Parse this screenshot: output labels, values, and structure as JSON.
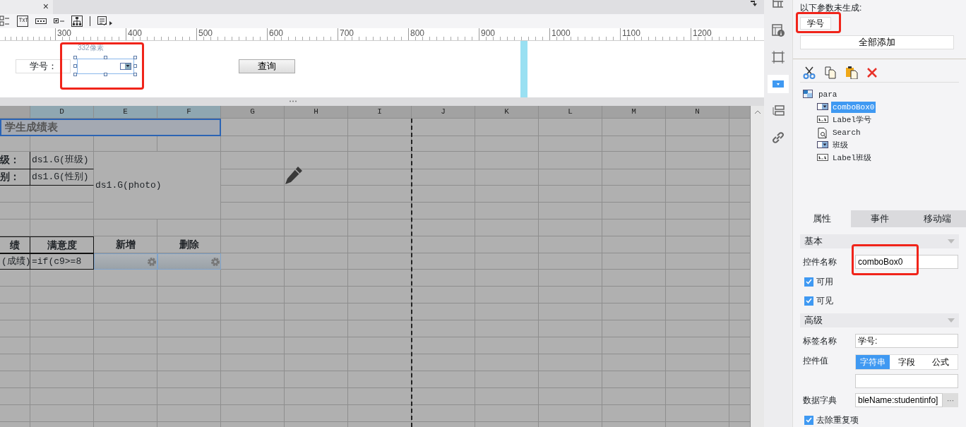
{
  "tab_bar": {
    "close": "×"
  },
  "ruler": {
    "labels": [
      "300",
      "400",
      "500",
      "600",
      "700",
      "800",
      "900",
      "1000",
      "1100",
      "1200"
    ]
  },
  "param_pane": {
    "label": "学号：",
    "size_hint": "332像素",
    "query_button": "查询"
  },
  "sheet": {
    "columns": [
      {
        "selected": false
      },
      {
        "label": "D",
        "selected": true
      },
      {
        "label": "E",
        "selected": true
      },
      {
        "label": "F",
        "selected": true
      },
      {
        "label": "G",
        "selected": false
      },
      {
        "label": "H",
        "selected": false
      },
      {
        "label": "I",
        "selected": false
      },
      {
        "label": "J",
        "selected": false
      },
      {
        "label": "K",
        "selected": false
      },
      {
        "label": "L",
        "selected": false
      },
      {
        "label": "M",
        "selected": false
      },
      {
        "label": "N",
        "selected": false
      }
    ],
    "cells": [
      {
        "kind": "title",
        "text": "学生成绩表",
        "selected": true
      },
      {
        "kind": "label",
        "text": "级：",
        "selected": false
      },
      {
        "kind": "formula",
        "text": "ds1.G(班级)",
        "selected": false
      },
      {
        "kind": "label",
        "text": "别：",
        "selected": false
      },
      {
        "kind": "formula",
        "text": "ds1.G(性别)",
        "selected": false
      },
      {
        "kind": "formula",
        "text": "ds1.G(photo)",
        "selected": false
      },
      {
        "kind": "header",
        "text": "绩",
        "selected": false
      },
      {
        "kind": "header",
        "text": "满意度",
        "selected": false
      },
      {
        "kind": "header",
        "text": "新增",
        "selected": false
      },
      {
        "kind": "header",
        "text": "删除",
        "selected": false
      },
      {
        "kind": "formula",
        "text": "(成绩)",
        "selected": false
      },
      {
        "kind": "formula",
        "text": "=if(c9>=8",
        "selected": false
      },
      {
        "kind": "widget",
        "selected": false
      },
      {
        "kind": "widget",
        "selected": false
      }
    ]
  },
  "side_strip": {
    "items": [
      {
        "kind": "layout",
        "selected": false
      },
      {
        "kind": "info",
        "selected": false
      },
      {
        "kind": "frame",
        "selected": false
      },
      {
        "kind": "combo",
        "selected": true
      },
      {
        "kind": "list",
        "selected": false
      },
      {
        "kind": "link",
        "selected": false
      }
    ]
  },
  "params": {
    "heading": "以下参数未生成:",
    "pending": [
      "学号"
    ],
    "add_all": "全部添加"
  },
  "widget_tree": {
    "label": "para",
    "kind": "panel",
    "selected": false,
    "children": [
      {
        "label": "comboBox0",
        "kind": "combo",
        "selected": true
      },
      {
        "label": "Label学号",
        "kind": "label",
        "selected": false
      },
      {
        "label": "Search",
        "kind": "search",
        "selected": false
      },
      {
        "label": "班级",
        "kind": "combo",
        "selected": false
      },
      {
        "label": "Label班级",
        "kind": "label",
        "selected": false
      }
    ]
  },
  "property_tabs": [
    {
      "label": "属性",
      "selected": true
    },
    {
      "label": "事件",
      "selected": false
    },
    {
      "label": "移动端",
      "selected": false
    }
  ],
  "properties": [
    {
      "kind": "section",
      "label": "基本"
    },
    {
      "kind": "input",
      "label": "控件名称",
      "value": "comboBox0"
    },
    {
      "kind": "check",
      "label": "可用",
      "checked": true
    },
    {
      "kind": "check",
      "label": "可见",
      "checked": true
    },
    {
      "kind": "section",
      "label": "高级"
    },
    {
      "kind": "input",
      "label": "标签名称",
      "value": "学号:"
    },
    {
      "kind": "segmented",
      "label": "控件值",
      "options": [
        {
          "label": "字符串",
          "selected": true
        },
        {
          "label": "字段",
          "selected": false
        },
        {
          "label": "公式",
          "selected": false
        }
      ]
    },
    {
      "kind": "input",
      "label": "数据字典",
      "value": "bleName:studentinfo]",
      "button": "···"
    },
    {
      "kind": "check",
      "label": "去除重复项",
      "checked": true
    }
  ]
}
